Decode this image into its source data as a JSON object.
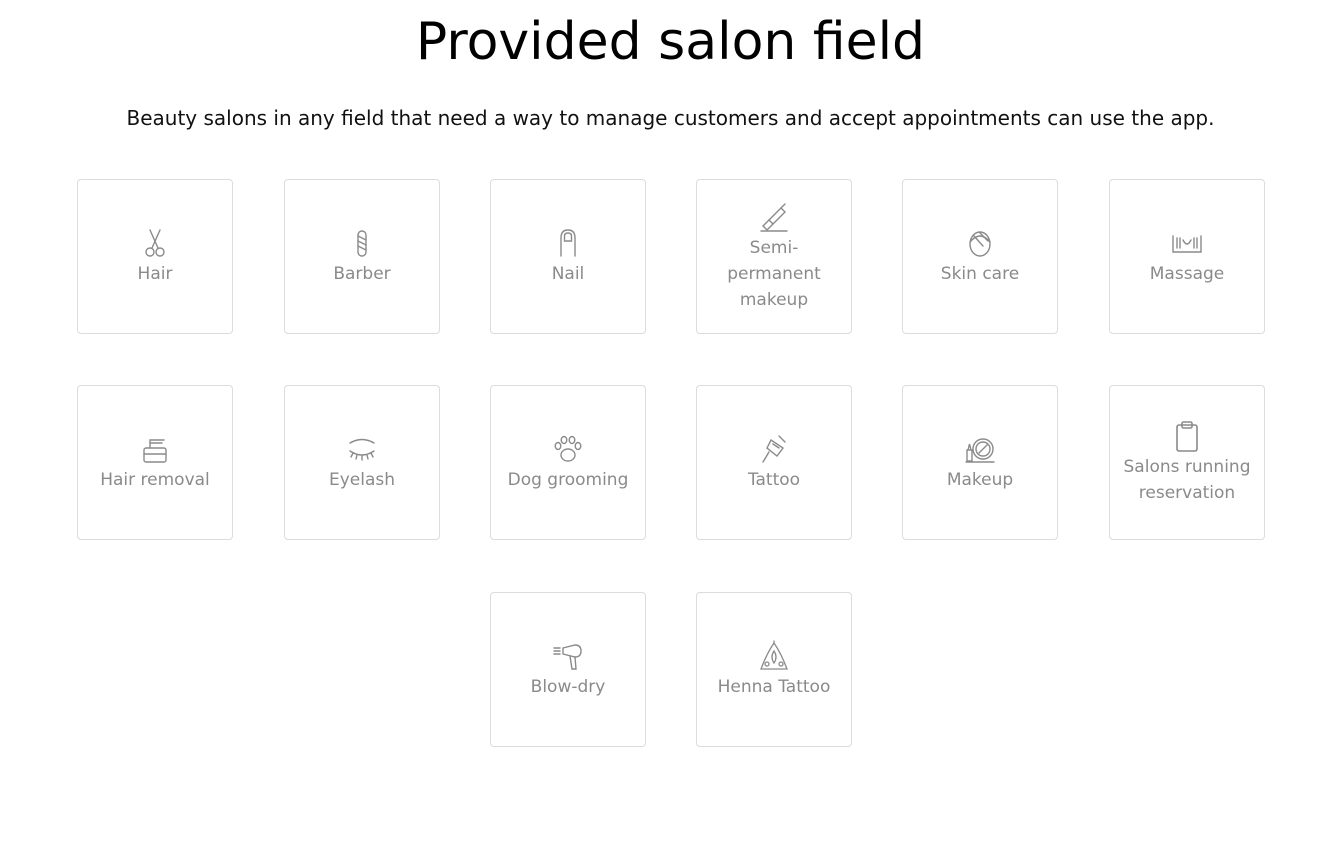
{
  "heading": {
    "title": "Provided salon field",
    "subtitle": "Beauty salons in any field that need a way to manage customers and accept appointments can use the app."
  },
  "colors": {
    "icon_stroke": "#8a8a8a",
    "label_text": "#8a8a8a",
    "tile_border": "#dcdcdc"
  },
  "fields": [
    {
      "label": "Hair",
      "icon": "scissors-icon"
    },
    {
      "label": "Barber",
      "icon": "barber-pole-icon"
    },
    {
      "label": "Nail",
      "icon": "fingernail-icon"
    },
    {
      "label": "Semi-permanent makeup",
      "icon": "tattoo-pen-icon"
    },
    {
      "label": "Skin care",
      "icon": "face-towel-icon"
    },
    {
      "label": "Massage",
      "icon": "massage-hands-icon"
    },
    {
      "label": "Hair removal",
      "icon": "wax-warmer-icon"
    },
    {
      "label": "Eyelash",
      "icon": "eyelash-icon"
    },
    {
      "label": "Dog grooming",
      "icon": "paw-icon"
    },
    {
      "label": "Tattoo",
      "icon": "tattoo-machine-icon"
    },
    {
      "label": "Makeup",
      "icon": "compact-mirror-icon"
    },
    {
      "label": "Salons running reservation",
      "icon": "clipboard-icon"
    },
    {
      "label": "Blow-dry",
      "icon": "hair-dryer-icon"
    },
    {
      "label": "Henna Tattoo",
      "icon": "henna-pattern-icon"
    }
  ]
}
